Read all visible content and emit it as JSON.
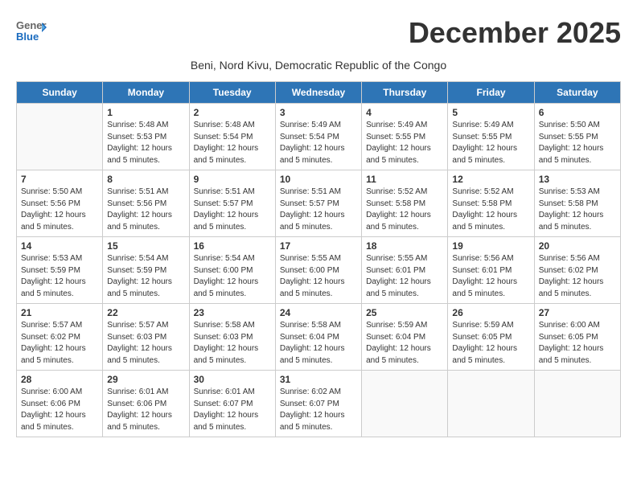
{
  "logo": {
    "general": "General",
    "blue": "Blue"
  },
  "title": "December 2025",
  "subtitle": "Beni, Nord Kivu, Democratic Republic of the Congo",
  "days_of_week": [
    "Sunday",
    "Monday",
    "Tuesday",
    "Wednesday",
    "Thursday",
    "Friday",
    "Saturday"
  ],
  "weeks": [
    [
      {
        "day": "",
        "info": ""
      },
      {
        "day": "1",
        "info": "Sunrise: 5:48 AM\nSunset: 5:53 PM\nDaylight: 12 hours\nand 5 minutes."
      },
      {
        "day": "2",
        "info": "Sunrise: 5:48 AM\nSunset: 5:54 PM\nDaylight: 12 hours\nand 5 minutes."
      },
      {
        "day": "3",
        "info": "Sunrise: 5:49 AM\nSunset: 5:54 PM\nDaylight: 12 hours\nand 5 minutes."
      },
      {
        "day": "4",
        "info": "Sunrise: 5:49 AM\nSunset: 5:55 PM\nDaylight: 12 hours\nand 5 minutes."
      },
      {
        "day": "5",
        "info": "Sunrise: 5:49 AM\nSunset: 5:55 PM\nDaylight: 12 hours\nand 5 minutes."
      },
      {
        "day": "6",
        "info": "Sunrise: 5:50 AM\nSunset: 5:55 PM\nDaylight: 12 hours\nand 5 minutes."
      }
    ],
    [
      {
        "day": "7",
        "info": "Sunrise: 5:50 AM\nSunset: 5:56 PM\nDaylight: 12 hours\nand 5 minutes."
      },
      {
        "day": "8",
        "info": "Sunrise: 5:51 AM\nSunset: 5:56 PM\nDaylight: 12 hours\nand 5 minutes."
      },
      {
        "day": "9",
        "info": "Sunrise: 5:51 AM\nSunset: 5:57 PM\nDaylight: 12 hours\nand 5 minutes."
      },
      {
        "day": "10",
        "info": "Sunrise: 5:51 AM\nSunset: 5:57 PM\nDaylight: 12 hours\nand 5 minutes."
      },
      {
        "day": "11",
        "info": "Sunrise: 5:52 AM\nSunset: 5:58 PM\nDaylight: 12 hours\nand 5 minutes."
      },
      {
        "day": "12",
        "info": "Sunrise: 5:52 AM\nSunset: 5:58 PM\nDaylight: 12 hours\nand 5 minutes."
      },
      {
        "day": "13",
        "info": "Sunrise: 5:53 AM\nSunset: 5:58 PM\nDaylight: 12 hours\nand 5 minutes."
      }
    ],
    [
      {
        "day": "14",
        "info": "Sunrise: 5:53 AM\nSunset: 5:59 PM\nDaylight: 12 hours\nand 5 minutes."
      },
      {
        "day": "15",
        "info": "Sunrise: 5:54 AM\nSunset: 5:59 PM\nDaylight: 12 hours\nand 5 minutes."
      },
      {
        "day": "16",
        "info": "Sunrise: 5:54 AM\nSunset: 6:00 PM\nDaylight: 12 hours\nand 5 minutes."
      },
      {
        "day": "17",
        "info": "Sunrise: 5:55 AM\nSunset: 6:00 PM\nDaylight: 12 hours\nand 5 minutes."
      },
      {
        "day": "18",
        "info": "Sunrise: 5:55 AM\nSunset: 6:01 PM\nDaylight: 12 hours\nand 5 minutes."
      },
      {
        "day": "19",
        "info": "Sunrise: 5:56 AM\nSunset: 6:01 PM\nDaylight: 12 hours\nand 5 minutes."
      },
      {
        "day": "20",
        "info": "Sunrise: 5:56 AM\nSunset: 6:02 PM\nDaylight: 12 hours\nand 5 minutes."
      }
    ],
    [
      {
        "day": "21",
        "info": "Sunrise: 5:57 AM\nSunset: 6:02 PM\nDaylight: 12 hours\nand 5 minutes."
      },
      {
        "day": "22",
        "info": "Sunrise: 5:57 AM\nSunset: 6:03 PM\nDaylight: 12 hours\nand 5 minutes."
      },
      {
        "day": "23",
        "info": "Sunrise: 5:58 AM\nSunset: 6:03 PM\nDaylight: 12 hours\nand 5 minutes."
      },
      {
        "day": "24",
        "info": "Sunrise: 5:58 AM\nSunset: 6:04 PM\nDaylight: 12 hours\nand 5 minutes."
      },
      {
        "day": "25",
        "info": "Sunrise: 5:59 AM\nSunset: 6:04 PM\nDaylight: 12 hours\nand 5 minutes."
      },
      {
        "day": "26",
        "info": "Sunrise: 5:59 AM\nSunset: 6:05 PM\nDaylight: 12 hours\nand 5 minutes."
      },
      {
        "day": "27",
        "info": "Sunrise: 6:00 AM\nSunset: 6:05 PM\nDaylight: 12 hours\nand 5 minutes."
      }
    ],
    [
      {
        "day": "28",
        "info": "Sunrise: 6:00 AM\nSunset: 6:06 PM\nDaylight: 12 hours\nand 5 minutes."
      },
      {
        "day": "29",
        "info": "Sunrise: 6:01 AM\nSunset: 6:06 PM\nDaylight: 12 hours\nand 5 minutes."
      },
      {
        "day": "30",
        "info": "Sunrise: 6:01 AM\nSunset: 6:07 PM\nDaylight: 12 hours\nand 5 minutes."
      },
      {
        "day": "31",
        "info": "Sunrise: 6:02 AM\nSunset: 6:07 PM\nDaylight: 12 hours\nand 5 minutes."
      },
      {
        "day": "",
        "info": ""
      },
      {
        "day": "",
        "info": ""
      },
      {
        "day": "",
        "info": ""
      }
    ]
  ]
}
